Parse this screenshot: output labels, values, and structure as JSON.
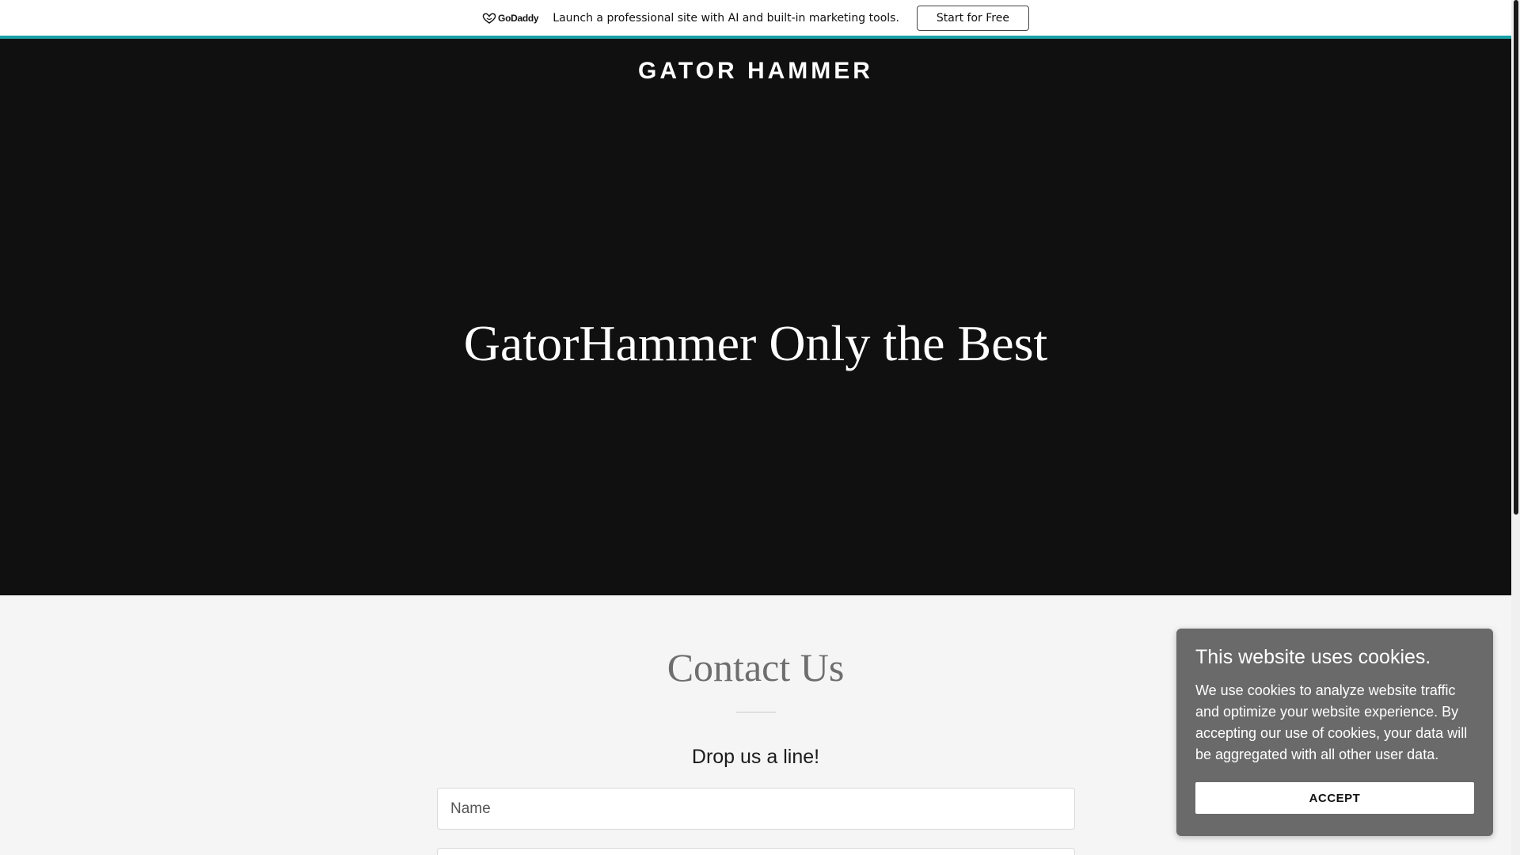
{
  "promo": {
    "logo_text": "GoDaddy",
    "logo_icon": "godaddy-heart-icon",
    "message": "Launch a professional site with AI and built-in marketing tools.",
    "cta_label": "Start for Free",
    "accent_color": "#1aa1a7"
  },
  "header": {
    "site_title": "GATOR HAMMER"
  },
  "hero": {
    "tagline": "GatorHammer Only the Best",
    "background_color": "#101010"
  },
  "contact": {
    "title": "Contact Us",
    "subtitle": "Drop us a line!",
    "name_placeholder": "Name",
    "email_placeholder": ""
  },
  "cookie_banner": {
    "title": "This website uses cookies.",
    "body": "We use cookies to analyze website traffic and optimize your website experience. By accepting our use of cookies, your data will be aggregated with all other user data.",
    "accept_label": "ACCEPT"
  }
}
